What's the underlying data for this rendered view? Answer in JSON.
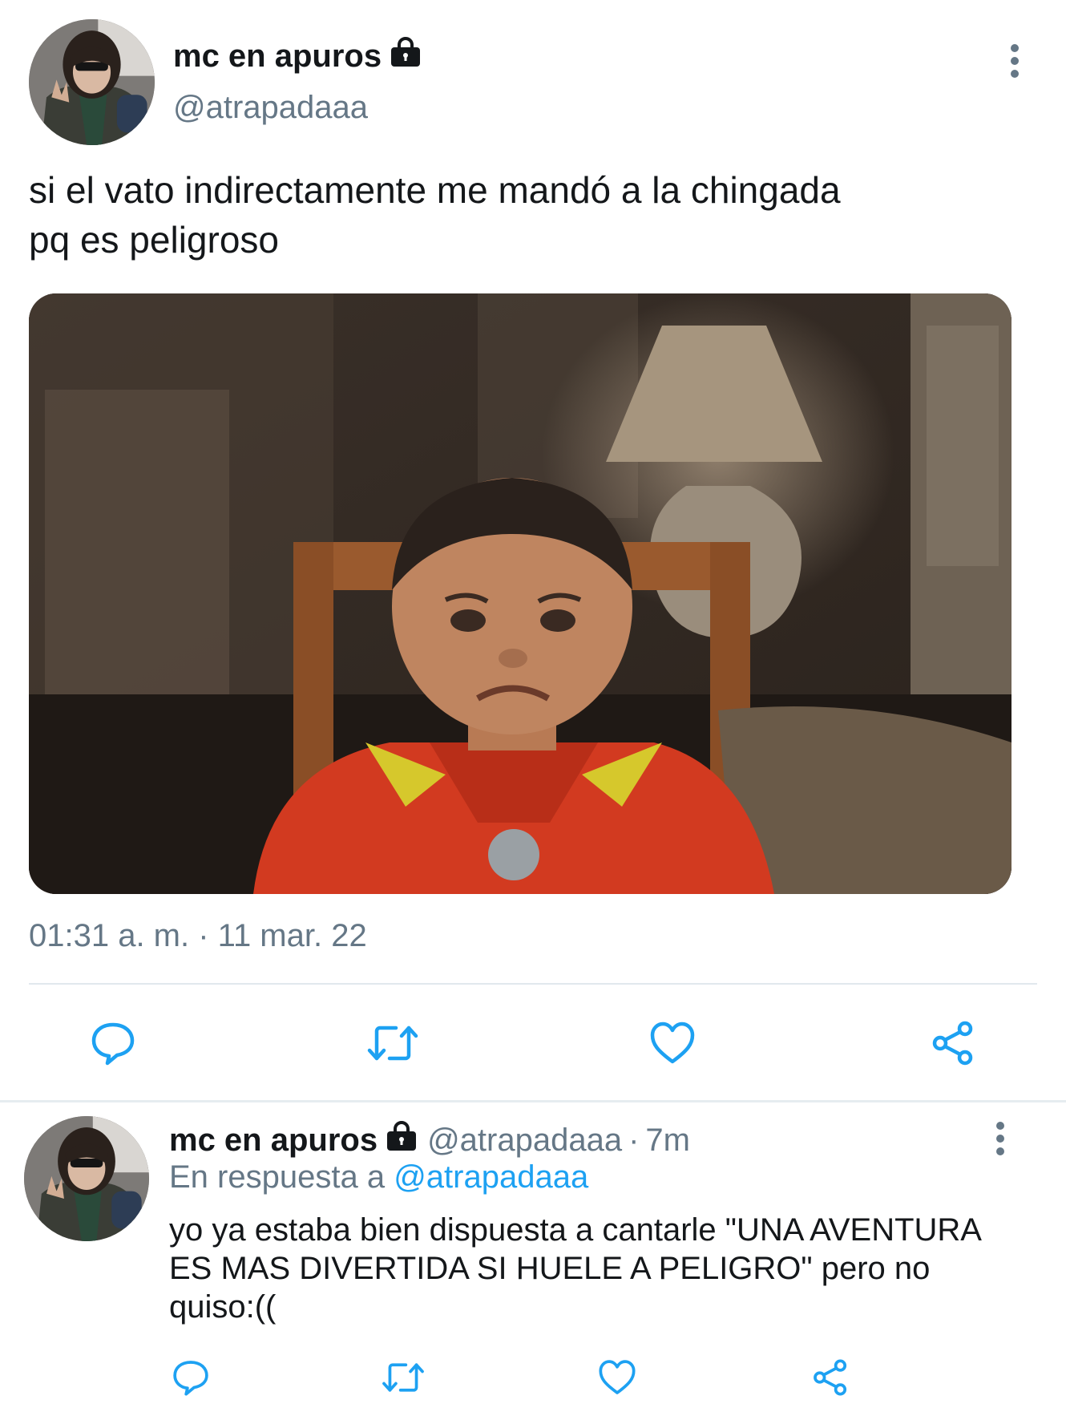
{
  "tweet": {
    "display_name": "mc en apuros",
    "handle": "@atrapadaaa",
    "text_line1": "si el vato indirectamente me mandó a la chingada",
    "text_line2": "pq es peligroso",
    "timestamp": "01:31 a. m. · 11 mar. 22",
    "actions": [
      "reply-icon",
      "retweet-icon",
      "like-icon",
      "share-icon"
    ]
  },
  "reply": {
    "display_name": "mc en apuros",
    "handle": "@atrapadaaa",
    "separator": "·",
    "time_ago": "7m",
    "in_reply_to_label": "En respuesta a",
    "in_reply_to_handle": "@atrapadaaa",
    "text_line1": "yo ya estaba bien dispuesta a cantarle \"UNA AVENTURA",
    "text_line2": "ES MAS DIVERTIDA SI HUELE A PELIGRO\" pero no",
    "text_line3": "quiso:((",
    "actions": [
      "reply-icon",
      "retweet-icon",
      "like-icon",
      "share-icon"
    ]
  },
  "colors": {
    "text": "#14171a",
    "secondary": "#657786",
    "accent": "#1da1f2",
    "divider": "#e1e8ed"
  }
}
